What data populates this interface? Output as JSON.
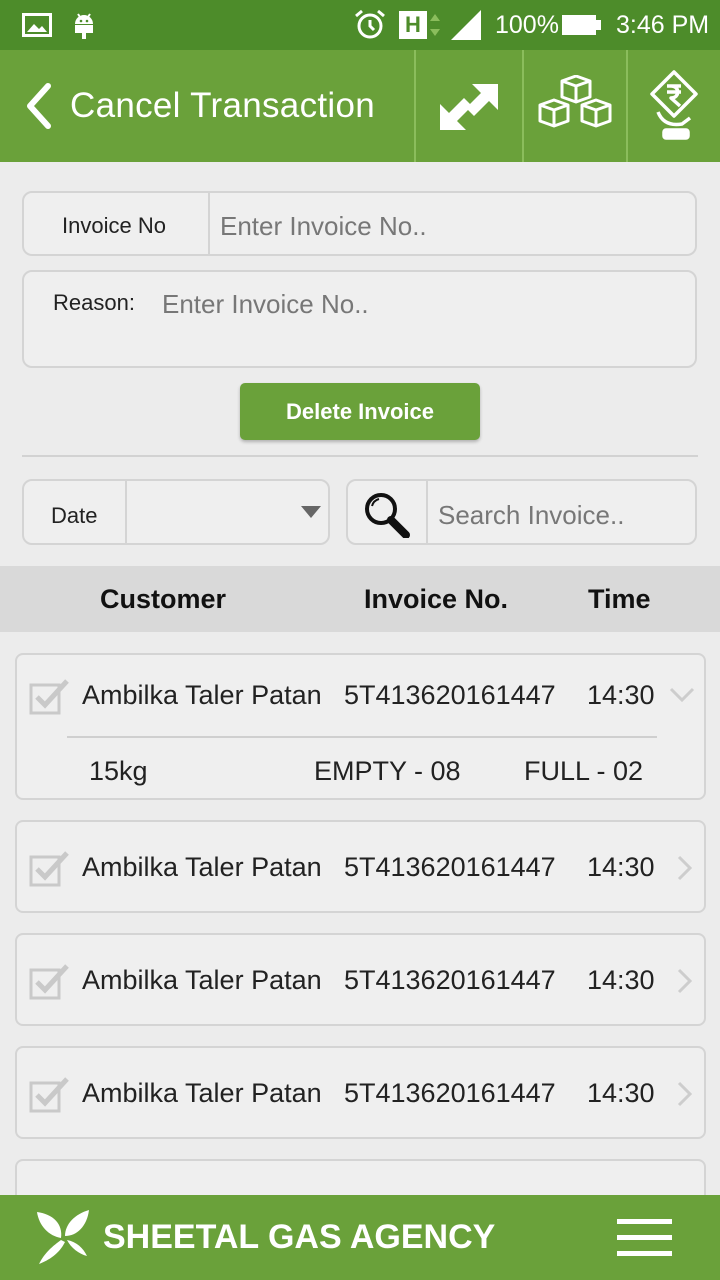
{
  "status_bar": {
    "battery": "100%",
    "time": "3:46 PM",
    "network_label": "H",
    "icons": [
      "image-notification-icon",
      "android-icon",
      "alarm-icon",
      "signal-icon",
      "battery-icon"
    ]
  },
  "app_bar": {
    "title": "Cancel Transaction",
    "icons": [
      "transfer-icon",
      "boxes-icon",
      "rupee-payment-icon"
    ]
  },
  "cancel_form": {
    "invoice_label": "Invoice No",
    "invoice_placeholder": "Enter Invoice No..",
    "invoice_value": "",
    "reason_label": "Reason:",
    "reason_placeholder": "Enter Invoice No..",
    "reason_value": "",
    "delete_button": "Delete Invoice"
  },
  "filters": {
    "date_label": "Date",
    "date_value": "",
    "search_placeholder": "Search Invoice.."
  },
  "table": {
    "headers": [
      "Customer",
      "Invoice No.",
      "Time"
    ],
    "rows": [
      {
        "customer": "Ambilka Taler Patan",
        "invoice": "5T413620161447",
        "time": "14:30",
        "expanded": true,
        "details": {
          "size": "15kg",
          "empty": "EMPTY - 08",
          "full": "FULL - 02"
        }
      },
      {
        "customer": "Ambilka Taler Patan",
        "invoice": "5T413620161447",
        "time": "14:30",
        "expanded": false
      },
      {
        "customer": "Ambilka Taler Patan",
        "invoice": "5T413620161447",
        "time": "14:30",
        "expanded": false
      },
      {
        "customer": "Ambilka Taler Patan",
        "invoice": "5T413620161447",
        "time": "14:30",
        "expanded": false
      }
    ]
  },
  "footer": {
    "brand": "SHEETAL GAS AGENCY",
    "icons": [
      "leaf-logo-icon",
      "menu-icon"
    ]
  },
  "colors": {
    "status_bar": "#4d8c2a",
    "primary": "#6aa13a",
    "background": "#ececec",
    "header_row": "#d9d9d9"
  }
}
